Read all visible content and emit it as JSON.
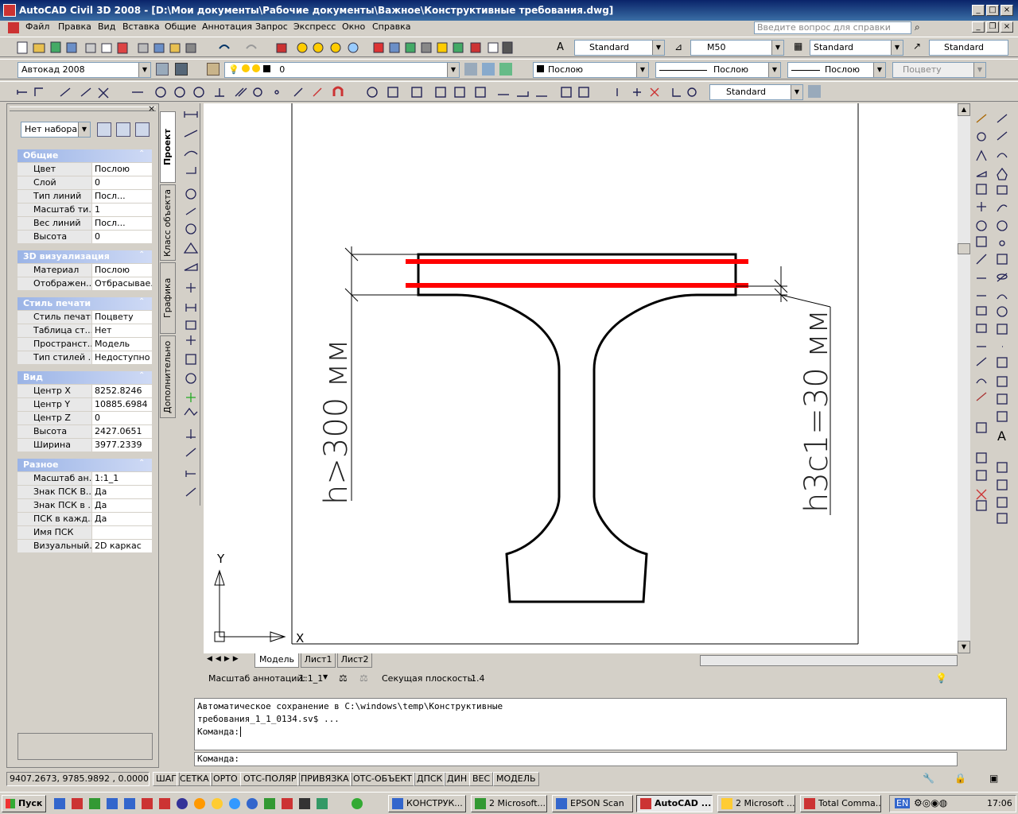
{
  "window": {
    "title": "AutoCAD Civil 3D 2008 - [D:\\Мои документы\\Рабочие документы\\Важное\\Конструктивные требования.dwg]",
    "help_placeholder": "Введите вопрос для справки"
  },
  "menu": [
    "Файл",
    "Правка",
    "Вид",
    "Вставка",
    "Общие",
    "Аннотация",
    "Запрос",
    "Экспресс",
    "Окно",
    "Справка"
  ],
  "toolbar1": {
    "text_style": "Standard",
    "dim_style": "M50",
    "table_style": "Standard",
    "mleader_style": "Standard"
  },
  "toolbar2": {
    "workspace": "Автокад 2008",
    "layer": "0",
    "color": "Послою",
    "linetype": "Послою",
    "lineweight": "Послою",
    "plotstyle": "Поцвету"
  },
  "toolbar3": {
    "dim_style": "Standard"
  },
  "properties": {
    "selection": "Нет набора",
    "sections": [
      {
        "title": "Общие",
        "rows": [
          [
            "Цвет",
            "Послою"
          ],
          [
            "Слой",
            "0"
          ],
          [
            "Тип линий",
            "Посл..."
          ],
          [
            "Масштаб ти...",
            "1"
          ],
          [
            "Вес линий",
            "Посл..."
          ],
          [
            "Высота",
            "0"
          ]
        ]
      },
      {
        "title": "3D визуализация",
        "rows": [
          [
            "Материал",
            "Послою"
          ],
          [
            "Отображен...",
            "Отбрасывае..."
          ]
        ]
      },
      {
        "title": "Стиль печати",
        "rows": [
          [
            "Стиль печати",
            "Поцвету"
          ],
          [
            "Таблица ст...",
            "Нет"
          ],
          [
            "Пространст...",
            "Модель"
          ],
          [
            "Тип стилей ...",
            "Недоступно"
          ]
        ]
      },
      {
        "title": "Вид",
        "rows": [
          [
            "Центр X",
            "8252.8246"
          ],
          [
            "Центр Y",
            "10885.6984"
          ],
          [
            "Центр Z",
            "0"
          ],
          [
            "Высота",
            "2427.0651"
          ],
          [
            "Ширина",
            "3977.2339"
          ]
        ]
      },
      {
        "title": "Разное",
        "rows": [
          [
            "Масштаб ан...",
            "1:1_1"
          ],
          [
            "Знак ПСК В...",
            "Да"
          ],
          [
            "Знак ПСК в ...",
            "Да"
          ],
          [
            "ПСК в кажд...",
            "Да"
          ],
          [
            "Имя ПСК",
            ""
          ],
          [
            "Визуальный...",
            "2D каркас"
          ]
        ]
      }
    ]
  },
  "side_tabs": [
    "Проект",
    "Класс объекта",
    "Графика",
    "Дополнительно"
  ],
  "drawing": {
    "label_left": "h>300 мм",
    "label_right": "h3c1=30 мм",
    "ucs_x": "X",
    "ucs_y": "Y"
  },
  "layout_tabs": [
    "Модель",
    "Лист1",
    "Лист2"
  ],
  "annotation": {
    "scale_label": "Масштаб аннотаций:",
    "scale_value": "1:1_1",
    "section_label": "Секущая плоскость:",
    "section_value": "1.4"
  },
  "command": {
    "history": [
      "Автоматическое сохранение в C:\\windows\\temp\\Конструктивные",
      "требования_1_1_0134.sv$ ...",
      "Команда:"
    ],
    "prompt": "Команда:"
  },
  "status": {
    "coords": "9407.2673, 9785.9892 , 0.0000",
    "buttons": [
      "ШАГ",
      "СЕТКА",
      "ОРТО",
      "ОТС-ПОЛЯР",
      "ПРИВЯЗКА",
      "ОТС-ОБЪЕКТ",
      "ДПСК",
      "ДИН",
      "ВЕС",
      "МОДЕЛЬ"
    ]
  },
  "taskbar": {
    "start": "Пуск",
    "tasks": [
      "КОНСТРУК...",
      "2 Microsoft...",
      "EPSON Scan",
      "AutoCAD ...",
      "2 Microsoft ...",
      "Total Comma..."
    ],
    "lang": "EN",
    "clock": "17:06"
  },
  "colors": {
    "highlight": "#ff0000",
    "title_blue": "#0a246a"
  }
}
